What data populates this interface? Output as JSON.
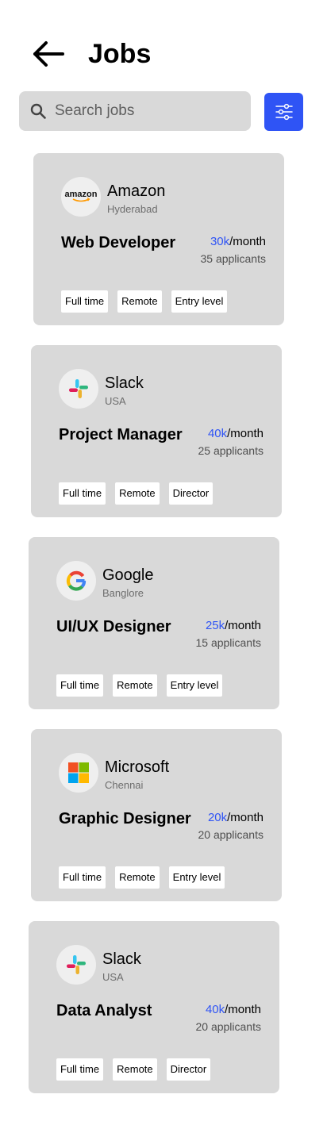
{
  "header": {
    "title": "Jobs",
    "back_icon": "arrow-left-icon"
  },
  "search": {
    "placeholder": "Search jobs",
    "value": "",
    "icon": "search-icon"
  },
  "filter": {
    "icon": "sliders-icon",
    "color": "#2f54f5"
  },
  "colors": {
    "accent": "#2f54f5",
    "card": "#d9d9d9"
  },
  "jobs": [
    {
      "company": "Amazon",
      "location": "Hyderabad",
      "logo": "amazon-logo",
      "role": "Web Developer",
      "salary_amount": "30k",
      "salary_period": "/month",
      "applicants": "35 applicants",
      "tags": [
        "Full time",
        "Remote",
        "Entry level"
      ]
    },
    {
      "company": "Slack",
      "location": "USA",
      "logo": "slack-logo",
      "role": "Project Manager",
      "salary_amount": "40k",
      "salary_period": "/month",
      "applicants": "25 applicants",
      "tags": [
        "Full time",
        "Remote",
        "Director"
      ]
    },
    {
      "company": "Google",
      "location": "Banglore",
      "logo": "google-logo",
      "role": "UI/UX Designer",
      "salary_amount": "25k",
      "salary_period": "/month",
      "applicants": "15 applicants",
      "tags": [
        "Full time",
        "Remote",
        "Entry level"
      ]
    },
    {
      "company": "Microsoft",
      "location": "Chennai",
      "logo": "microsoft-logo",
      "role": "Graphic Designer",
      "salary_amount": "20k",
      "salary_period": "/month",
      "applicants": "20 applicants",
      "tags": [
        "Full time",
        "Remote",
        "Entry level"
      ]
    },
    {
      "company": "Slack",
      "location": "USA",
      "logo": "slack-logo",
      "role": "Data Analyst",
      "salary_amount": "40k",
      "salary_period": "/month",
      "applicants": "20 applicants",
      "tags": [
        "Full time",
        "Remote",
        "Director"
      ]
    }
  ]
}
